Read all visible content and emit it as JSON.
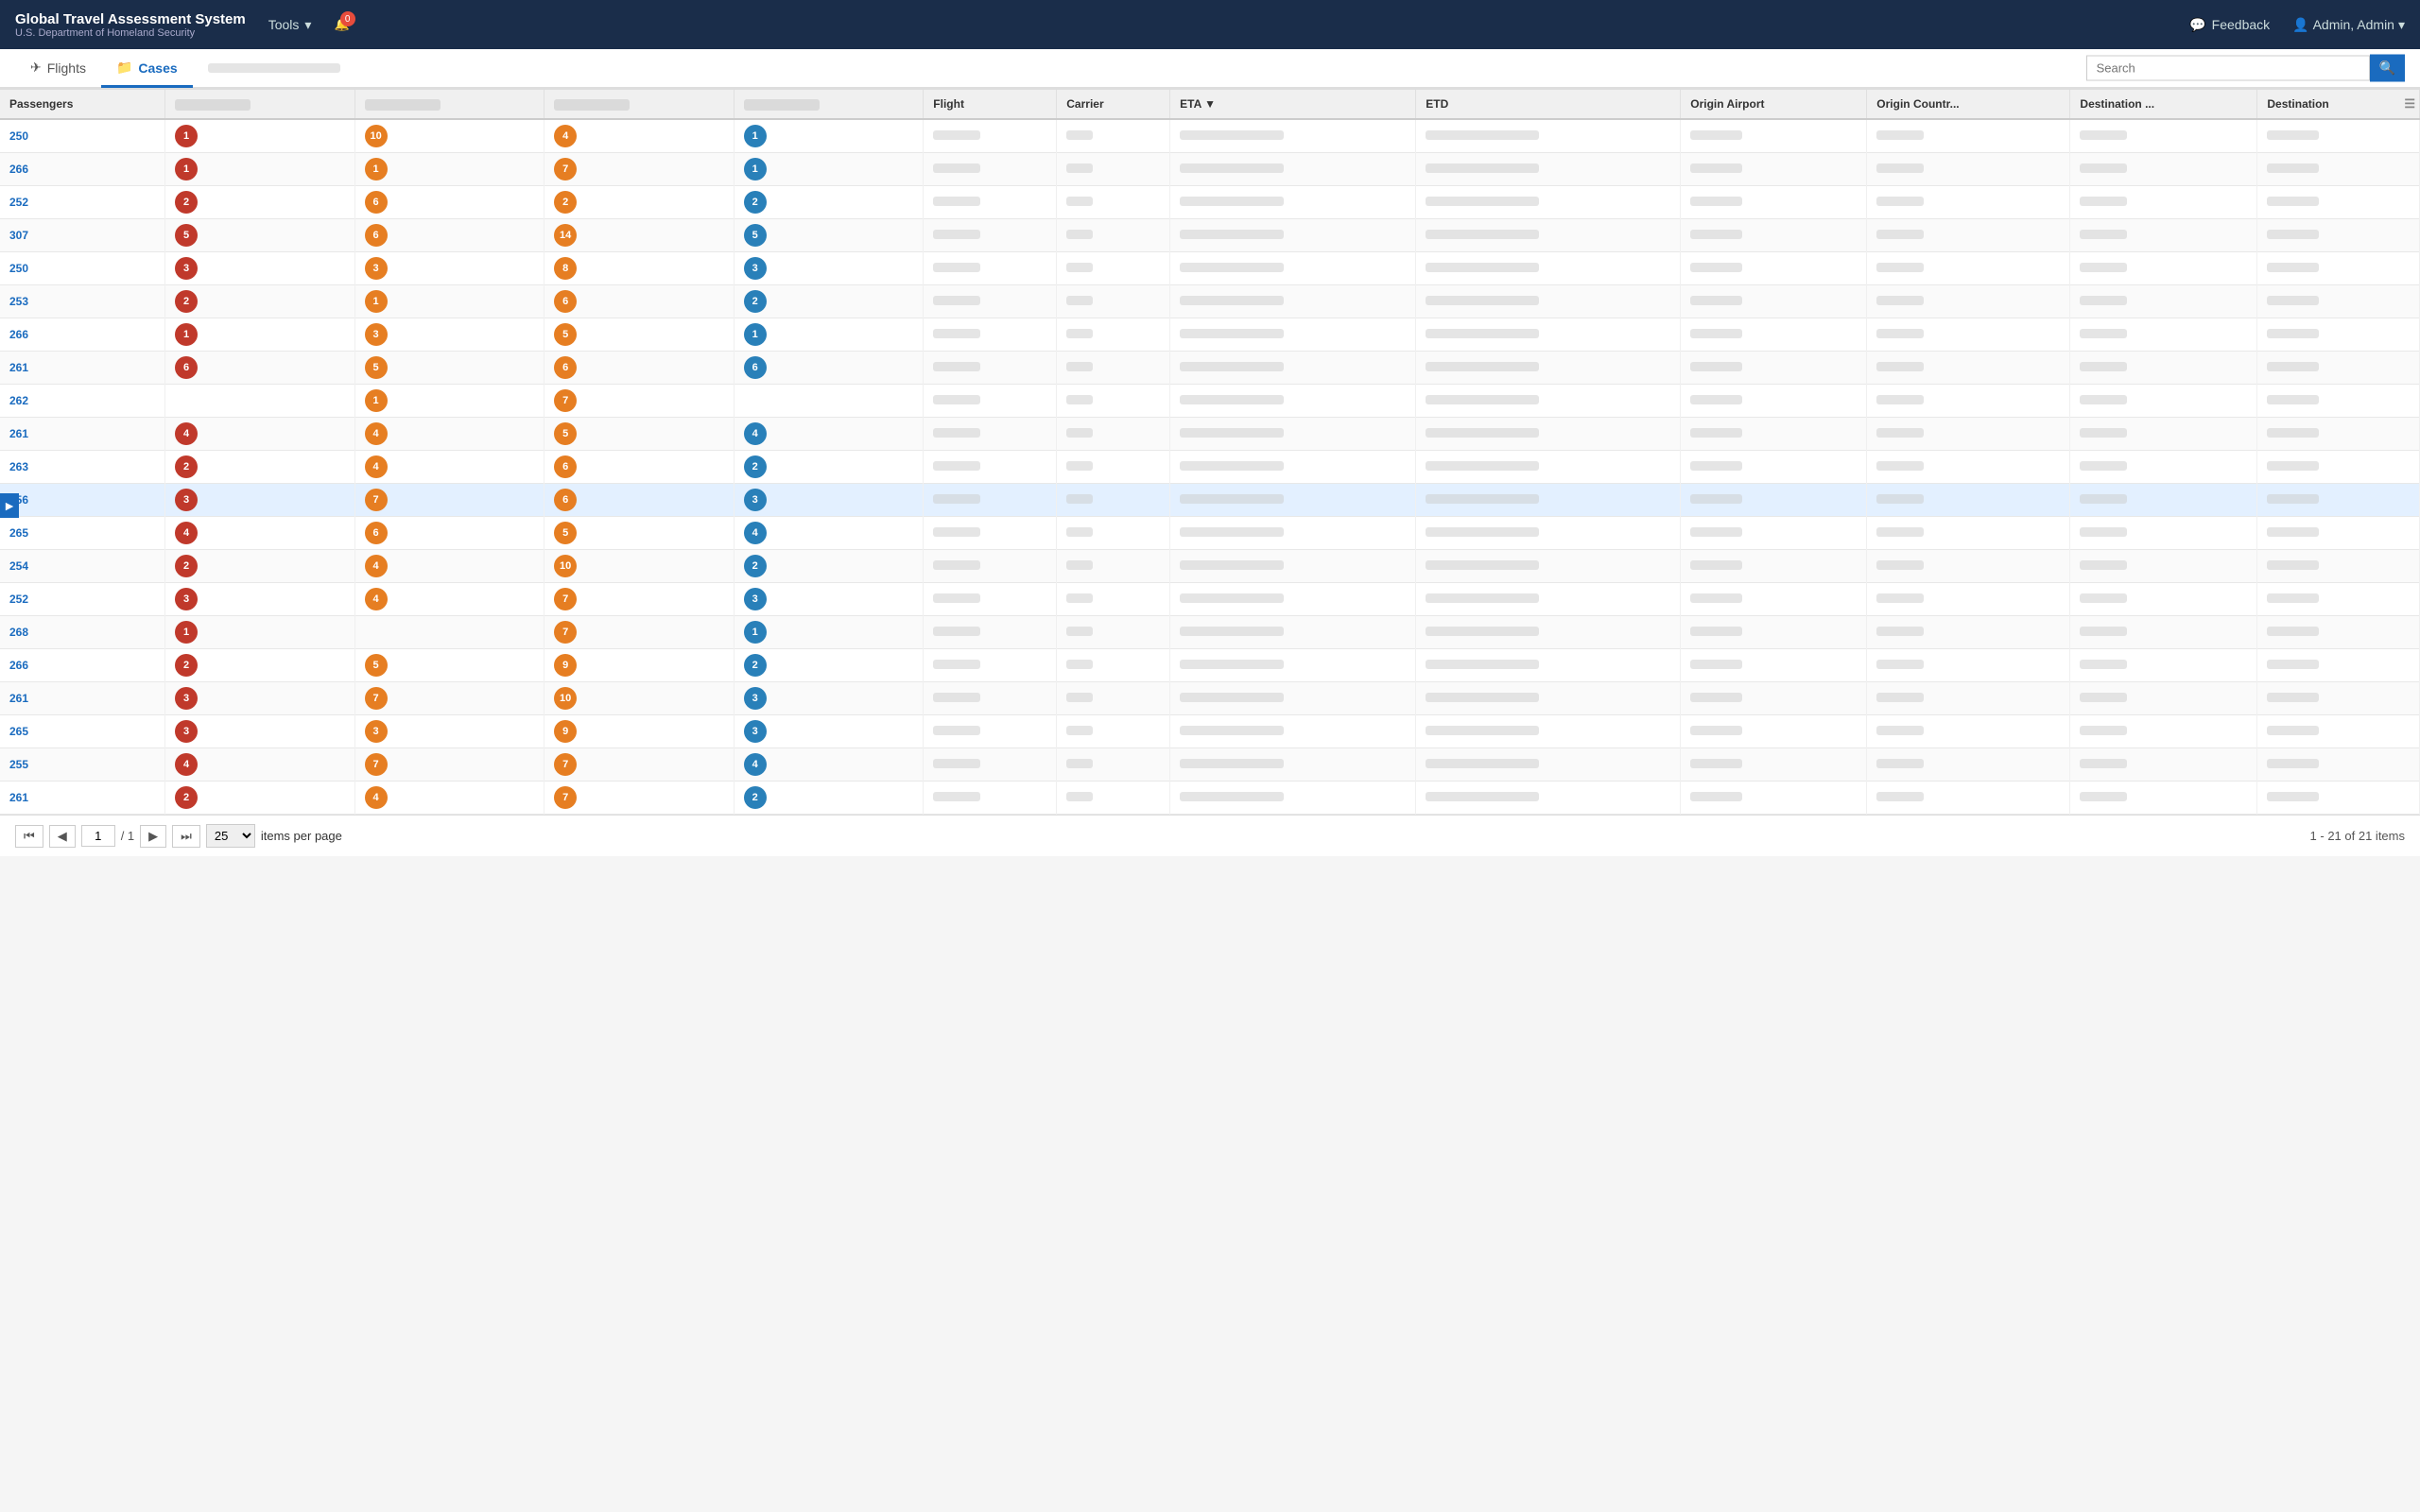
{
  "app": {
    "title": "Global Travel Assessment System",
    "subtitle": "U.S. Department of Homeland Security",
    "tools_label": "Tools",
    "bell_count": "0",
    "feedback_label": "Feedback",
    "user_label": "Admin, Admin"
  },
  "tabs": {
    "flights_label": "Flights",
    "cases_label": "Cases",
    "extra_label": ""
  },
  "search": {
    "placeholder": "Search",
    "value": ""
  },
  "table": {
    "columns": [
      "Passengers",
      "",
      "",
      "",
      "",
      "Flight",
      "Carrier",
      "ETA",
      "ETD",
      "Origin Airport",
      "Origin Countr...",
      "Destination ...",
      "Destination"
    ],
    "rows": [
      {
        "passengers": 250,
        "c1": 1,
        "c1color": "red",
        "c2": 10,
        "c2color": "orange",
        "c3": 4,
        "c3color": "orange",
        "c4": 1,
        "c4color": "blue"
      },
      {
        "passengers": 266,
        "c1": 1,
        "c1color": "red",
        "c2": 1,
        "c2color": "orange",
        "c3": 7,
        "c3color": "orange",
        "c4": 1,
        "c4color": "blue"
      },
      {
        "passengers": 252,
        "c1": 2,
        "c1color": "red",
        "c2": 6,
        "c2color": "orange",
        "c3": 2,
        "c3color": "orange",
        "c4": 2,
        "c4color": "blue"
      },
      {
        "passengers": 307,
        "c1": 5,
        "c1color": "red",
        "c2": 6,
        "c2color": "orange",
        "c3": 14,
        "c3color": "orange",
        "c4": 5,
        "c4color": "blue"
      },
      {
        "passengers": 250,
        "c1": 3,
        "c1color": "red",
        "c2": 3,
        "c2color": "orange",
        "c3": 8,
        "c3color": "orange",
        "c4": 3,
        "c4color": "blue"
      },
      {
        "passengers": 253,
        "c1": 2,
        "c1color": "red",
        "c2": 1,
        "c2color": "orange",
        "c3": 6,
        "c3color": "orange",
        "c4": 2,
        "c4color": "blue"
      },
      {
        "passengers": 266,
        "c1": 1,
        "c1color": "red",
        "c2": 3,
        "c2color": "orange",
        "c3": 5,
        "c3color": "orange",
        "c4": 1,
        "c4color": "blue"
      },
      {
        "passengers": 261,
        "c1": 6,
        "c1color": "red",
        "c2": 5,
        "c2color": "orange",
        "c3": 6,
        "c3color": "orange",
        "c4": 6,
        "c4color": "blue"
      },
      {
        "passengers": 262,
        "c1": null,
        "c1color": "",
        "c2": 1,
        "c2color": "orange",
        "c3": 7,
        "c3color": "orange",
        "c4": null,
        "c4color": ""
      },
      {
        "passengers": 261,
        "c1": 4,
        "c1color": "red",
        "c2": 4,
        "c2color": "orange",
        "c3": 5,
        "c3color": "orange",
        "c4": 4,
        "c4color": "blue"
      },
      {
        "passengers": 263,
        "c1": 2,
        "c1color": "red",
        "c2": 4,
        "c2color": "orange",
        "c3": 6,
        "c3color": "orange",
        "c4": 2,
        "c4color": "blue"
      },
      {
        "passengers": 256,
        "c1": 3,
        "c1color": "red",
        "c2": 7,
        "c2color": "orange",
        "c3": 6,
        "c3color": "orange",
        "c4": 3,
        "c4color": "blue",
        "highlighted": true
      },
      {
        "passengers": 265,
        "c1": 4,
        "c1color": "red",
        "c2": 6,
        "c2color": "orange",
        "c3": 5,
        "c3color": "orange",
        "c4": 4,
        "c4color": "blue"
      },
      {
        "passengers": 254,
        "c1": 2,
        "c1color": "red",
        "c2": 4,
        "c2color": "orange",
        "c3": 10,
        "c3color": "orange",
        "c4": 2,
        "c4color": "blue"
      },
      {
        "passengers": 252,
        "c1": 3,
        "c1color": "red",
        "c2": 4,
        "c2color": "orange",
        "c3": 7,
        "c3color": "orange",
        "c4": 3,
        "c4color": "blue"
      },
      {
        "passengers": 268,
        "c1": 1,
        "c1color": "red",
        "c2": null,
        "c2color": "",
        "c3": 7,
        "c3color": "orange",
        "c4": 1,
        "c4color": "blue"
      },
      {
        "passengers": 266,
        "c1": 2,
        "c1color": "red",
        "c2": 5,
        "c2color": "orange",
        "c3": 9,
        "c3color": "orange",
        "c4": 2,
        "c4color": "blue"
      },
      {
        "passengers": 261,
        "c1": 3,
        "c1color": "red",
        "c2": 7,
        "c2color": "orange",
        "c3": 10,
        "c3color": "orange",
        "c4": 3,
        "c4color": "blue"
      },
      {
        "passengers": 265,
        "c1": 3,
        "c1color": "red",
        "c2": 3,
        "c2color": "orange",
        "c3": 9,
        "c3color": "orange",
        "c4": 3,
        "c4color": "blue"
      },
      {
        "passengers": 255,
        "c1": 4,
        "c1color": "red",
        "c2": 7,
        "c2color": "orange",
        "c3": 7,
        "c3color": "orange",
        "c4": 4,
        "c4color": "blue"
      },
      {
        "passengers": 261,
        "c1": 2,
        "c1color": "red",
        "c2": 4,
        "c2color": "orange",
        "c3": 7,
        "c3color": "orange",
        "c4": 2,
        "c4color": "blue"
      }
    ]
  },
  "pagination": {
    "current_page": "1",
    "total_pages": "1",
    "items_per_page": "25",
    "items_label": "items per page",
    "summary": "1 - 21 of 21 items"
  }
}
